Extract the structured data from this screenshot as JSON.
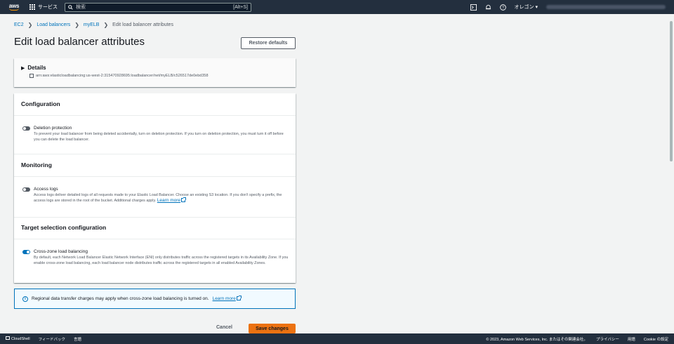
{
  "nav": {
    "logo": "aws",
    "services_label": "サービス",
    "search_placeholder": "検索",
    "search_shortcut": "[Alt+S]",
    "region": "オレゴン ▾",
    "icons": [
      "cloudshell-icon",
      "bell-icon",
      "help-icon"
    ]
  },
  "breadcrumb": {
    "items": [
      "EC2",
      "Load balancers",
      "myELB"
    ],
    "current": "Edit load balancer attributes"
  },
  "page": {
    "title": "Edit load balancer attributes",
    "restore_label": "Restore defaults"
  },
  "details": {
    "title": "Details",
    "arn": "arn:aws:elasticloadbalancing:us-west-2:315470928695:loadbalancer/net/myELB/c526517de0ebd358"
  },
  "configuration": {
    "title": "Configuration",
    "deletion_protection": {
      "label": "Deletion protection",
      "enabled": false,
      "desc": "To prevent your load balancer from being deleted accidentally, turn on deletion protection. If you turn on deletion protection, you must turn it off before you can delete the load balancer."
    }
  },
  "monitoring": {
    "title": "Monitoring",
    "access_logs": {
      "label": "Access logs",
      "enabled": false,
      "desc": "Access logs deliver detailed logs of all requests made to your Elastic Load Balancer. Choose an existing S3 location. If you don't specify a prefix, the access logs are stored in the root of the bucket. Additional charges apply.",
      "learn_more": "Learn more"
    }
  },
  "target": {
    "title": "Target selection configuration",
    "cross_zone": {
      "label": "Cross-zone load balancing",
      "enabled": true,
      "desc": "By default, each Network Load Balancer Elastic Network Interface (ENI) only distributes traffic across the registered targets in its Availability Zone. If you enable cross-zone load balancing, each load balancer node distributes traffic across the registered targets in all enabled Availability Zones."
    }
  },
  "info": {
    "text": "Regional data transfer charges may apply when cross-zone load balancing is turned on.",
    "learn_more": "Learn more"
  },
  "actions": {
    "cancel": "Cancel",
    "save": "Save changes"
  },
  "footer": {
    "cloudshell": "CloudShell",
    "feedback": "フィードバック",
    "language": "言語",
    "copyright": "© 2023, Amazon Web Services, Inc. またはその関連会社。",
    "privacy": "プライバシー",
    "terms": "用語",
    "cookie": "Cookie の設定"
  },
  "colors": {
    "nav_bg": "#232f3e",
    "link": "#0073bb",
    "primary_button": "#ec7211"
  }
}
